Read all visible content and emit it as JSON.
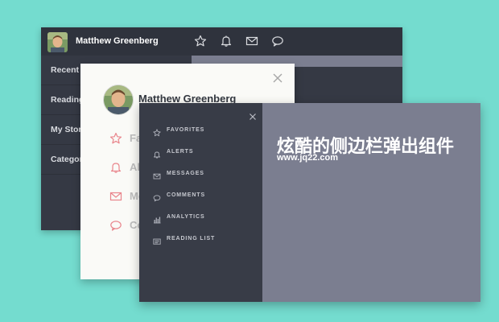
{
  "colors": {
    "background": "#74dccf",
    "dark_panel": "#353944",
    "front_content": "#7b7e90",
    "light_panel": "#fafaf7",
    "accent_icon": "#e9858c"
  },
  "back_panel": {
    "user_name": "Matthew Greenberg",
    "header_icons": [
      "star-icon",
      "bell-icon",
      "mail-icon",
      "chat-icon"
    ],
    "menu": [
      {
        "label": "Recent S"
      },
      {
        "label": "Reading"
      },
      {
        "label": "My Storie"
      },
      {
        "label": "Categori"
      }
    ]
  },
  "middle_panel": {
    "user_name": "Matthew Greenberg",
    "menu": [
      {
        "label": "Fa",
        "icon": "star-icon"
      },
      {
        "label": "Al",
        "icon": "bell-icon"
      },
      {
        "label": "Me",
        "icon": "mail-icon"
      },
      {
        "label": "Co",
        "icon": "chat-icon"
      }
    ]
  },
  "front_panel": {
    "menu": [
      {
        "label": "FAVORITES",
        "icon": "star-icon"
      },
      {
        "label": "ALERTS",
        "icon": "bell-icon"
      },
      {
        "label": "MESSAGES",
        "icon": "mail-icon"
      },
      {
        "label": "COMMENTS",
        "icon": "chat-icon"
      },
      {
        "label": "ANALYTICS",
        "icon": "bar-chart-icon"
      },
      {
        "label": "READING LIST",
        "icon": "book-icon"
      }
    ],
    "title": "炫酷的侧边栏弹出组件",
    "url": "www.jq22.com"
  }
}
